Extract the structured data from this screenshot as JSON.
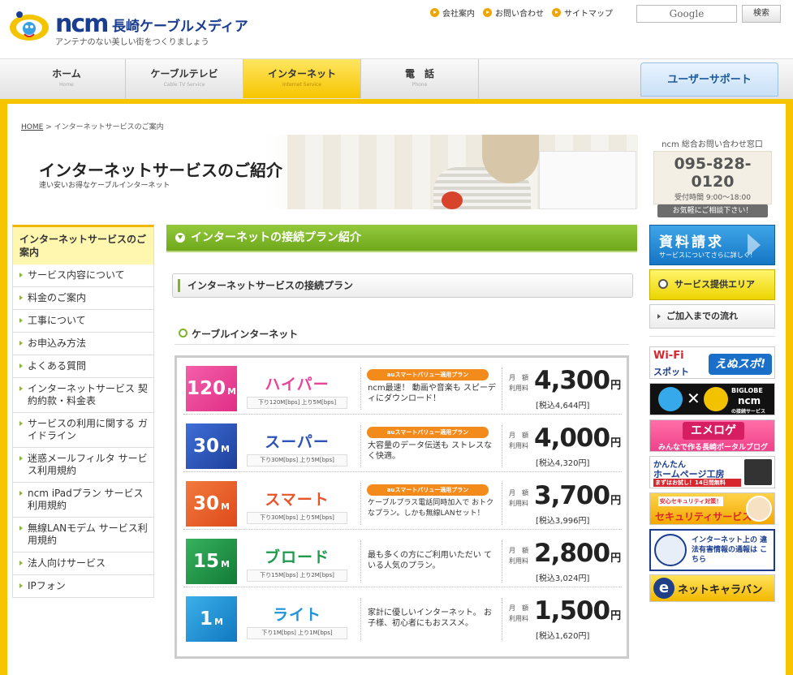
{
  "header": {
    "brand": "ncm",
    "brand_jp": "長崎ケーブルメディア",
    "tagline": "アンテナのない美しい街をつくりましょう",
    "links": [
      "会社案内",
      "お問い合わせ",
      "サイトマップ"
    ],
    "search_placeholder": "Google",
    "search_button": "検索"
  },
  "nav": {
    "tabs": [
      {
        "label": "ホーム",
        "sub": "Home"
      },
      {
        "label": "ケーブルテレビ",
        "sub": "Cable TV Service"
      },
      {
        "label": "インターネット",
        "sub": "Internet Service",
        "active": true
      },
      {
        "label": "電　話",
        "sub": "Phone"
      }
    ],
    "user_support": "ユーザーサポート"
  },
  "breadcrumb": {
    "home": "HOME",
    "separator": ">",
    "current": "インターネットサービスのご案内"
  },
  "hero": {
    "title": "インターネットサービスのご紹介",
    "subtitle": "速い安いお得なケーブルインターネット"
  },
  "contact": {
    "heading": "ncm 総合お問い合わせ窓口",
    "tel": "095-828-0120",
    "hours_label": "受付時間",
    "hours": "9:00～18:00",
    "note": "お気軽にご相談下さい！"
  },
  "sidebar": {
    "heading": "インターネットサービスのご案内",
    "items": [
      "サービス内容について",
      "料金のご案内",
      "工事について",
      "お申込み方法",
      "よくある質問",
      "インターネットサービス 契約約款・料金表",
      "サービスの利用に関する ガイドライン",
      "迷惑メールフィルタ サービス利用規約",
      "ncm iPadプラン サービス利用規約",
      "無線LANモデム サービス利用規約",
      "法人向けサービス",
      "IPフォン"
    ]
  },
  "main": {
    "section_title": "インターネットの接続プラン紹介",
    "sub_title": "インターネットサービスの接続プラン",
    "cable_heading": "ケーブルインターネット",
    "price_label_1": "月　額",
    "price_label_2": "利用料",
    "plans": [
      {
        "speed": "120",
        "unit": "M",
        "name": "ハイパー",
        "spec": "下り120M[bps] 上り5M[bps]",
        "badge": "auスマートバリュー適用プラン",
        "desc": "ncm最速！ 動画や音楽も スピーディにダウンロード！",
        "price": "4,300",
        "yen": "円",
        "tax": "[税込4,644円]",
        "color": "#e8459a",
        "name_color": "#e8459a"
      },
      {
        "speed": "30",
        "unit": "M",
        "name": "スーパー",
        "spec": "下り30M[bps] 上り5M[bps]",
        "badge": "auスマートバリュー適用プラン",
        "desc": "大容量のデータ伝送も ストレスなく快適。",
        "price": "4,000",
        "yen": "円",
        "tax": "[税込4,320円]",
        "color": "#2d52b8",
        "name_color": "#2d52b8"
      },
      {
        "speed": "30",
        "unit": "M",
        "name": "スマート",
        "spec": "下り30M[bps] 上り5M[bps]",
        "badge": "auスマートバリュー適用プラン",
        "desc": "ケーブルプラス電話同時加入で おトクなプラン。しかも無線LANセット！",
        "price": "3,700",
        "yen": "円",
        "tax": "[税込3,996円]",
        "color": "#e8542a",
        "name_color": "#e8542a"
      },
      {
        "speed": "15",
        "unit": "M",
        "name": "ブロード",
        "spec": "下り15M[bps] 上り2M[bps]",
        "badge": "",
        "desc": "最も多くの方にご利用いただい ている人気のプラン。",
        "price": "2,800",
        "yen": "円",
        "tax": "[税込3,024円]",
        "color": "#1e9a4a",
        "name_color": "#1e9a4a"
      },
      {
        "speed": "1",
        "unit": "M",
        "name": "ライト",
        "spec": "下り1M[bps] 上り1M[bps]",
        "badge": "",
        "desc": "家計に優しいインターネット。 お子様、初心者にもおススメ。",
        "price": "1,500",
        "yen": "円",
        "tax": "[税込1,620円]",
        "color": "#1d95d8",
        "name_color": "#1d95d8"
      }
    ]
  },
  "right": {
    "doc_title": "資料請求",
    "doc_sub": "サービスについてさらに詳しく！",
    "area": "サービス提供エリア",
    "flow": "ご加入までの流れ",
    "wifi_a": "Wi-Fi",
    "wifi_b": "スポット",
    "wifi_c": "えぬスポ!",
    "biglobe_t1": "BIGLOBE",
    "biglobe_t2": "ncm",
    "biglobe_t3": "の接続サービス",
    "emolog_a": "エメロゲ",
    "emolog_b": "みんなで作る長崎ポータルブログ",
    "homepage_a": "かんたん",
    "homepage_b": "ホームページ工房",
    "homepage_c": "まずはお試し！14日間無料",
    "security_a": "安心セキュリティ対策！",
    "security_b": "セキュリティサービス",
    "illegal": "インターネット上の 違法有害情報の通報は こちら",
    "ecaravan": "ネットキャラバン"
  }
}
